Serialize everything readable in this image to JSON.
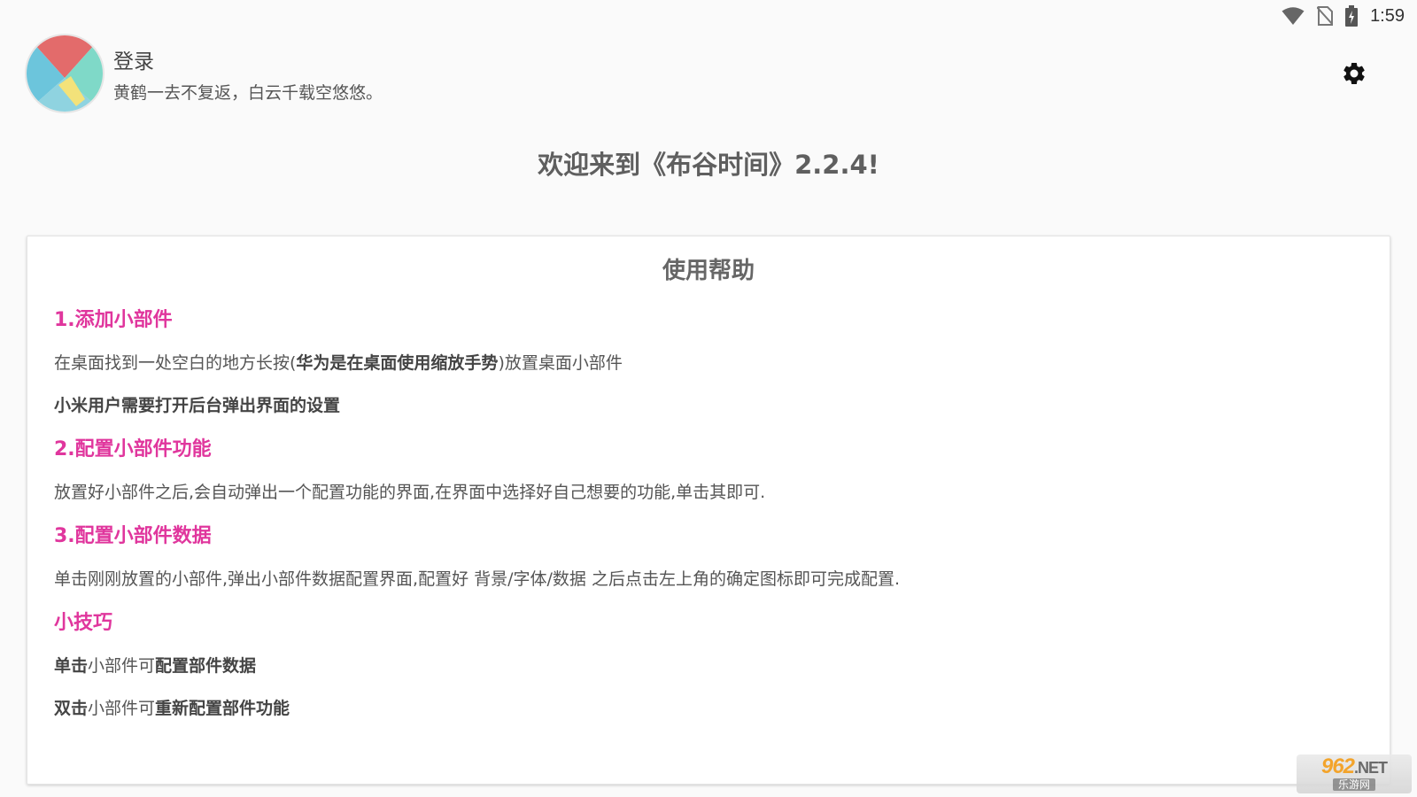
{
  "status_bar": {
    "time": "1:59",
    "icons": [
      "wifi-icon",
      "no-sim-icon",
      "battery-charging-icon"
    ]
  },
  "header": {
    "title": "登录",
    "subtitle": "黄鹤一去不复返，白云千载空悠悠。",
    "settings_icon": "gear-icon"
  },
  "welcome": {
    "text": "欢迎来到《布谷时间》2.2.4!"
  },
  "help": {
    "title": "使用帮助",
    "sections": [
      {
        "heading": "1.添加小部件",
        "lines": [
          {
            "part1": "在桌面找到一处空白的地方长按(",
            "bold": "华为是在桌面使用缩放手势",
            "part2": ")放置桌面小部件"
          },
          {
            "bold": "小米用户需要打开后台弹出界面的设置"
          }
        ]
      },
      {
        "heading": "2.配置小部件功能",
        "lines": [
          {
            "text": "放置好小部件之后,会自动弹出一个配置功能的界面,在界面中选择好自己想要的功能,单击其即可."
          }
        ]
      },
      {
        "heading": "3.配置小部件数据",
        "lines": [
          {
            "text": "单击刚刚放置的小部件,弹出小部件数据配置界面,配置好 背景/字体/数据 之后点击左上角的确定图标即可完成配置."
          }
        ]
      },
      {
        "heading": "小技巧",
        "lines": [
          {
            "bold1": "单击",
            "mid": "小部件可",
            "bold2": "配置部件数据"
          },
          {
            "bold1": "双击",
            "mid": "小部件可",
            "bold2": "重新配置部件功能"
          }
        ]
      }
    ]
  },
  "watermark": {
    "top": "962",
    "net": ".NET",
    "bottom": "乐游网"
  },
  "colors": {
    "accent": "#e0369d",
    "background": "#fafafa",
    "card": "#ffffff"
  }
}
